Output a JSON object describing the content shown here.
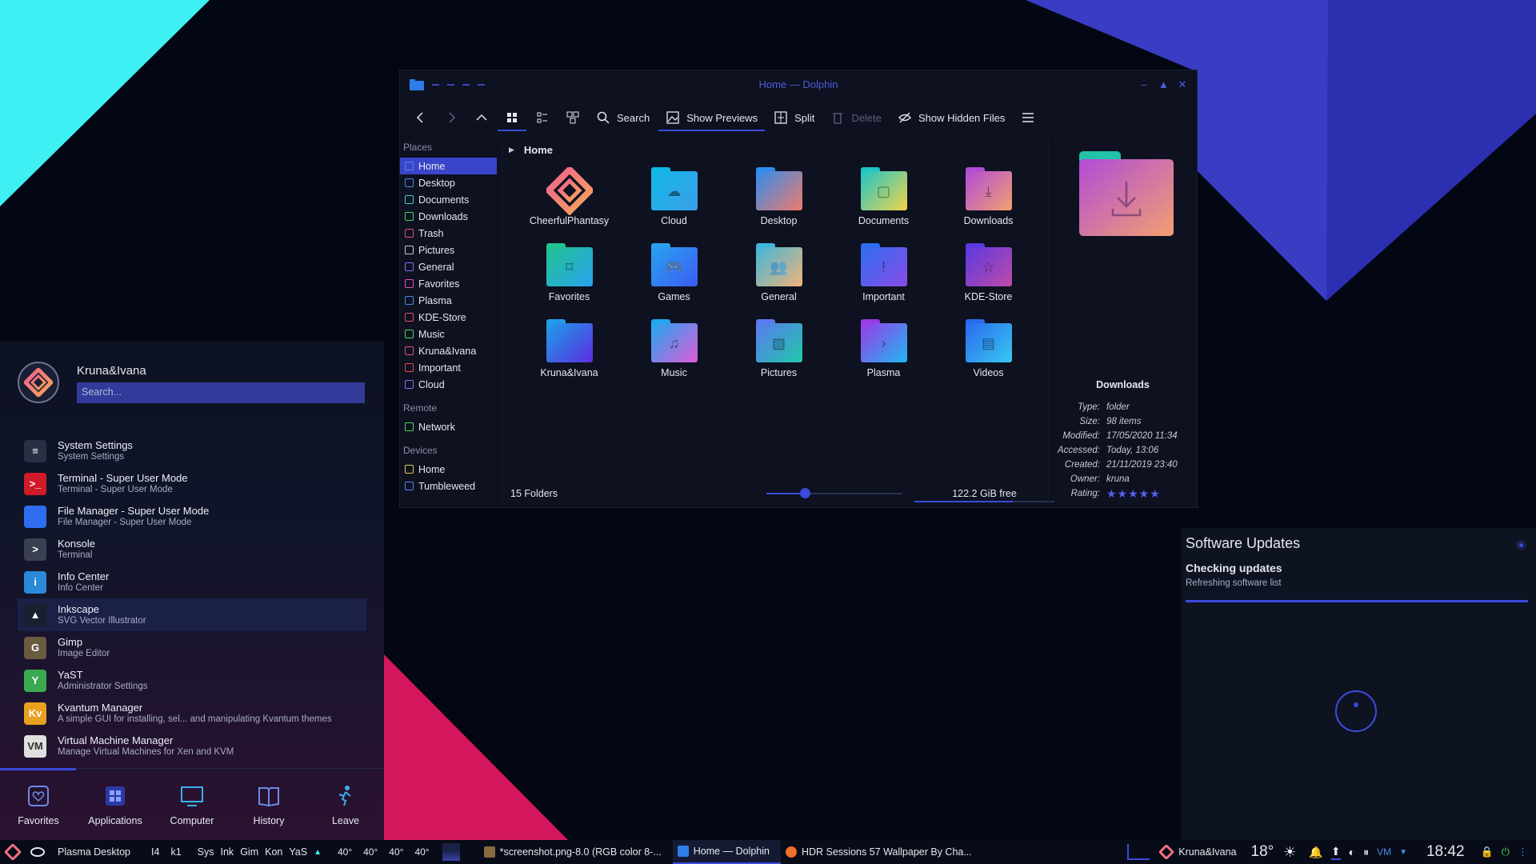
{
  "window": {
    "title": "Home — Dolphin",
    "controls": {
      "minimize": "–",
      "maximize": "▲",
      "close": "✕"
    }
  },
  "toolbar": {
    "search": "Search",
    "show_previews": "Show Previews",
    "split": "Split",
    "delete": "Delete",
    "show_hidden": "Show Hidden Files"
  },
  "places": {
    "places_header": "Places",
    "places_items": [
      {
        "label": "Home",
        "color": "#4b8be8"
      },
      {
        "label": "Desktop",
        "color": "#4b8be8"
      },
      {
        "label": "Documents",
        "color": "#3fd0d8"
      },
      {
        "label": "Downloads",
        "color": "#4bd860"
      },
      {
        "label": "Trash",
        "color": "#e84b8b"
      },
      {
        "label": "Pictures",
        "color": "#c8cbd9"
      },
      {
        "label": "General",
        "color": "#8a6bea"
      },
      {
        "label": "Favorites",
        "color": "#e84bc4"
      },
      {
        "label": "Plasma",
        "color": "#4b8be8"
      },
      {
        "label": "KDE-Store",
        "color": "#e84b60"
      },
      {
        "label": "Music",
        "color": "#4bd860"
      },
      {
        "label": "Kruna&Ivana",
        "color": "#e84b8b"
      },
      {
        "label": "Important",
        "color": "#e84b4b"
      },
      {
        "label": "Cloud",
        "color": "#8a6bea"
      }
    ],
    "remote_header": "Remote",
    "remote_items": [
      {
        "label": "Network",
        "color": "#4bd860"
      }
    ],
    "devices_header": "Devices",
    "devices_items": [
      {
        "label": "Home",
        "color": "#e8c44b"
      },
      {
        "label": "Tumbleweed",
        "color": "#4b8be8"
      }
    ]
  },
  "breadcrumb": {
    "current": "Home"
  },
  "files": [
    {
      "label": "CheerfulPhantasy",
      "kind": "logo",
      "c1": "#f25f8c",
      "c2": "#f5a85a",
      "glyph": ""
    },
    {
      "label": "Cloud",
      "kind": "folder",
      "c1": "#13b7e8",
      "c2": "#3aa0e8",
      "glyph": "☁"
    },
    {
      "label": "Desktop",
      "kind": "folder",
      "c1": "#2f8df0",
      "c2": "#f07b6a",
      "glyph": ""
    },
    {
      "label": "Documents",
      "kind": "folder",
      "c1": "#1fc4c8",
      "c2": "#f2d44a",
      "glyph": "▢"
    },
    {
      "label": "Downloads",
      "kind": "folder",
      "c1": "#b14bd8",
      "c2": "#f2a070",
      "glyph": "⤓"
    },
    {
      "label": "Favorites",
      "kind": "folder",
      "c1": "#22c38f",
      "c2": "#2aa1f0",
      "glyph": "⌑"
    },
    {
      "label": "Games",
      "kind": "folder",
      "c1": "#2aa1f0",
      "c2": "#3a5df0",
      "glyph": "🎮"
    },
    {
      "label": "General",
      "kind": "folder",
      "c1": "#3fb6d8",
      "c2": "#f2b47a",
      "glyph": "👥"
    },
    {
      "label": "Important",
      "kind": "folder",
      "c1": "#2e6df0",
      "c2": "#8a4ce8",
      "glyph": "!"
    },
    {
      "label": "KDE-Store",
      "kind": "folder",
      "c1": "#5a3ae0",
      "c2": "#c04aa8",
      "glyph": "☆"
    },
    {
      "label": "Kruna&Ivana",
      "kind": "folder",
      "c1": "#1e9ee8",
      "c2": "#5b2ee0",
      "glyph": ""
    },
    {
      "label": "Music",
      "kind": "folder",
      "c1": "#1ea8f0",
      "c2": "#e05ad8",
      "glyph": "♫"
    },
    {
      "label": "Pictures",
      "kind": "folder",
      "c1": "#5a7af0",
      "c2": "#20c8a8",
      "glyph": "▧"
    },
    {
      "label": "Plasma",
      "kind": "folder",
      "c1": "#9a3ae8",
      "c2": "#20b8f0",
      "glyph": "›"
    },
    {
      "label": "Videos",
      "kind": "folder",
      "c1": "#2a6af0",
      "c2": "#39c8f0",
      "glyph": "▤"
    }
  ],
  "status": {
    "count": "15 Folders",
    "free": "122.2 GiB free",
    "zoom_level": 0.28,
    "used_fraction": 0.7
  },
  "info": {
    "name": "Downloads",
    "rows": [
      {
        "k": "Type:",
        "v": "folder"
      },
      {
        "k": "Size:",
        "v": "98 items"
      },
      {
        "k": "Modified:",
        "v": "17/05/2020 11:34"
      },
      {
        "k": "Accessed:",
        "v": "Today, 13:06"
      },
      {
        "k": "Created:",
        "v": "21/11/2019 23:40"
      },
      {
        "k": "Owner:",
        "v": "kruna"
      }
    ],
    "rating_label": "Rating:",
    "rating_stars": "★★★★★",
    "rating_value": 5
  },
  "launcher": {
    "user": "Kruna&Ivana",
    "search_placeholder": "Search...",
    "apps": [
      {
        "title": "System Settings",
        "sub": "System Settings",
        "bg": "#2a3044",
        "fg": "#ffffff",
        "glyph": "≡",
        "highlight": false
      },
      {
        "title": "Terminal - Super User Mode",
        "sub": "Terminal - Super User Mode",
        "bg": "#d01a2a",
        "fg": "#ffffff",
        "glyph": ">_",
        "highlight": false
      },
      {
        "title": "File Manager - Super User Mode",
        "sub": "File Manager - Super User Mode",
        "bg": "#2e6df0",
        "fg": "#ffffff",
        "glyph": "",
        "highlight": false
      },
      {
        "title": "Konsole",
        "sub": "Terminal",
        "bg": "#3a4050",
        "fg": "#ffffff",
        "glyph": ">",
        "highlight": false
      },
      {
        "title": "Info Center",
        "sub": "Info Center",
        "bg": "#2a8ad8",
        "fg": "#ffffff",
        "glyph": "i",
        "highlight": false
      },
      {
        "title": "Inkscape",
        "sub": "SVG Vector Illustrator",
        "bg": "#1a1f30",
        "fg": "#ffffff",
        "glyph": "▲",
        "highlight": true
      },
      {
        "title": "Gimp",
        "sub": "Image Editor",
        "bg": "#6a5a40",
        "fg": "#ffffff",
        "glyph": "G",
        "highlight": false
      },
      {
        "title": "YaST",
        "sub": "Administrator Settings",
        "bg": "#3aa850",
        "fg": "#ffffff",
        "glyph": "Y",
        "highlight": false
      },
      {
        "title": "Kvantum Manager",
        "sub": "A simple GUI for installing, sel... and manipulating Kvantum themes",
        "bg": "#e8a020",
        "fg": "#ffffff",
        "glyph": "Kv",
        "highlight": false
      },
      {
        "title": "Virtual Machine Manager",
        "sub": "Manage Virtual Machines for Xen and KVM",
        "bg": "#e0e0e0",
        "fg": "#303030",
        "glyph": "VM",
        "highlight": false
      }
    ],
    "tabs": [
      {
        "label": "Favorites",
        "icon": "favorites-icon",
        "active": true
      },
      {
        "label": "Applications",
        "icon": "applications-icon",
        "active": false
      },
      {
        "label": "Computer",
        "icon": "computer-icon",
        "active": false
      },
      {
        "label": "History",
        "icon": "history-icon",
        "active": false
      },
      {
        "label": "Leave",
        "icon": "leave-icon",
        "active": false
      }
    ]
  },
  "updates": {
    "title": "Software Updates",
    "checking": "Checking updates",
    "detail": "Refreshing software list"
  },
  "taskbar": {
    "activity": "Plasma Desktop",
    "pager": [
      "I4",
      "k1"
    ],
    "quick": [
      "Sys",
      "Ink",
      "Gim",
      "Kon",
      "YaS"
    ],
    "temps": [
      "40°",
      "40°",
      "40°",
      "40°"
    ],
    "tasks": [
      {
        "label": "*screenshot.png-8.0 (RGB color 8-...",
        "active": false
      },
      {
        "label": "Home — Dolphin",
        "active": true
      },
      {
        "label": "HDR Sessions 57 Wallpaper By Cha...",
        "active": false
      }
    ],
    "user": "Kruna&Ivana",
    "weather": "18°",
    "clock": "18:42"
  },
  "colors": {
    "accent": "#3b4bdc",
    "window_bg": "#0d1120",
    "wall_cyan": "#3ef0f4",
    "wall_blue": "#3a3dc4",
    "wall_pink": "#d4165c"
  }
}
